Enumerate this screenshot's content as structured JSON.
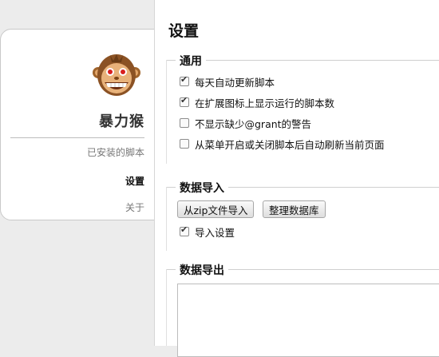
{
  "sidebar": {
    "app_name": "暴力猴",
    "logo": "monkey-logo",
    "nav": [
      {
        "label": "已安装的脚本",
        "active": false
      },
      {
        "label": "设置",
        "active": true
      },
      {
        "label": "关于",
        "active": false
      }
    ]
  },
  "main": {
    "title": "设置",
    "general": {
      "legend": "通用",
      "options": [
        {
          "label": "每天自动更新脚本",
          "checked": true
        },
        {
          "label": "在扩展图标上显示运行的脚本数",
          "checked": true
        },
        {
          "label": "不显示缺少@grant的警告",
          "checked": false
        },
        {
          "label": "从菜单开启或关闭脚本后自动刷新当前页面",
          "checked": false
        }
      ]
    },
    "import": {
      "legend": "数据导入",
      "buttons": [
        "从zip文件导入",
        "整理数据库"
      ],
      "option": {
        "label": "导入设置",
        "checked": true
      }
    },
    "export": {
      "legend": "数据导出",
      "textarea_value": ""
    }
  }
}
